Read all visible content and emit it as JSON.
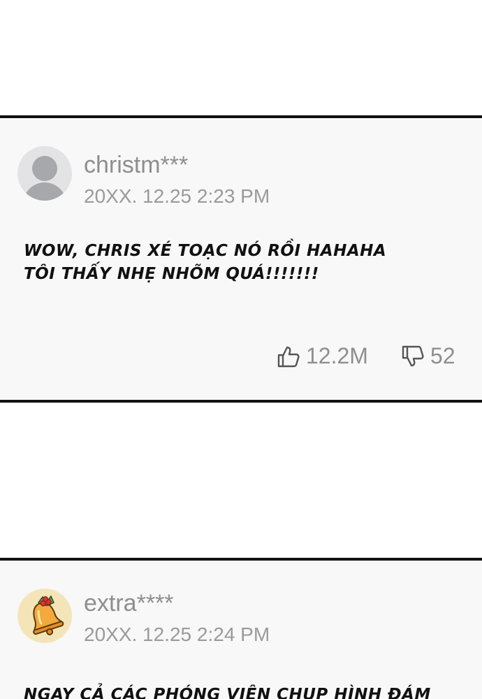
{
  "comments": [
    {
      "username": "christm***",
      "timestamp": "20XX. 12.25  2:23 PM",
      "text": "WOW, CHRIS XÉ TOẠC NÓ RỒI HAHAHA\nTÔI THẤY NHẸ NHÕM QUÁ!!!!!!!",
      "likes": "12.2M",
      "dislikes": "52",
      "avatar": "default-user-icon"
    },
    {
      "username": "extra****",
      "timestamp": "20XX. 12.25  2:24 PM",
      "text": "NGAY CẢ CÁC PHÓNG VIÊN CHỤP HÌNH ĐÁM",
      "avatar": "christmas-bell-icon"
    }
  ],
  "colors": {
    "card_background": "#f8f8f8",
    "border": "#111111",
    "meta_text": "#8e8e8e",
    "bell_avatar_bg": "#f4e5b9"
  }
}
